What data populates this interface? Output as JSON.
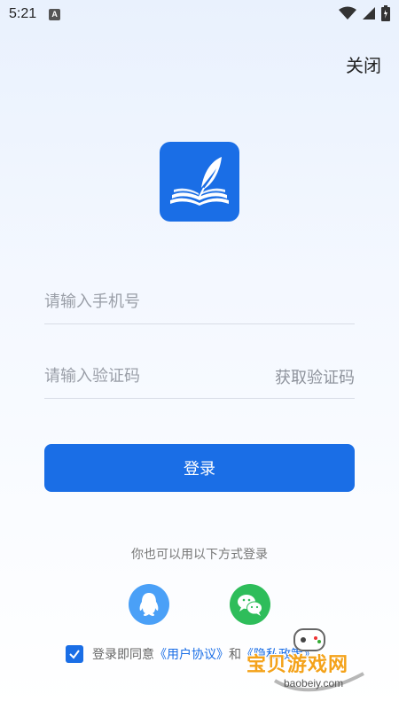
{
  "status_bar": {
    "time": "5:21",
    "notification_letter": "A",
    "icons": [
      "wifi-icon",
      "signal-icon",
      "battery-icon"
    ]
  },
  "header": {
    "close_label": "关闭"
  },
  "logo": {
    "icon": "book-quill-icon",
    "color": "#1a6ee6"
  },
  "form": {
    "phone_placeholder": "请输入手机号",
    "phone_value": "",
    "code_placeholder": "请输入验证码",
    "code_value": "",
    "get_code_label": "获取验证码",
    "login_label": "登录"
  },
  "alt_login": {
    "label": "你也可以用以下方式登录",
    "options": [
      {
        "icon": "qq-icon",
        "color": "#4aa0f7"
      },
      {
        "icon": "wechat-icon",
        "color": "#2ebd5a"
      }
    ]
  },
  "agreement": {
    "checked": true,
    "prefix": "登录即同意",
    "user_agreement": "《用户协议》",
    "conjunction": "和",
    "privacy_policy": "《隐私政策》"
  },
  "watermark": {
    "title": "宝贝游戏网",
    "url": "baobeiy.com"
  }
}
